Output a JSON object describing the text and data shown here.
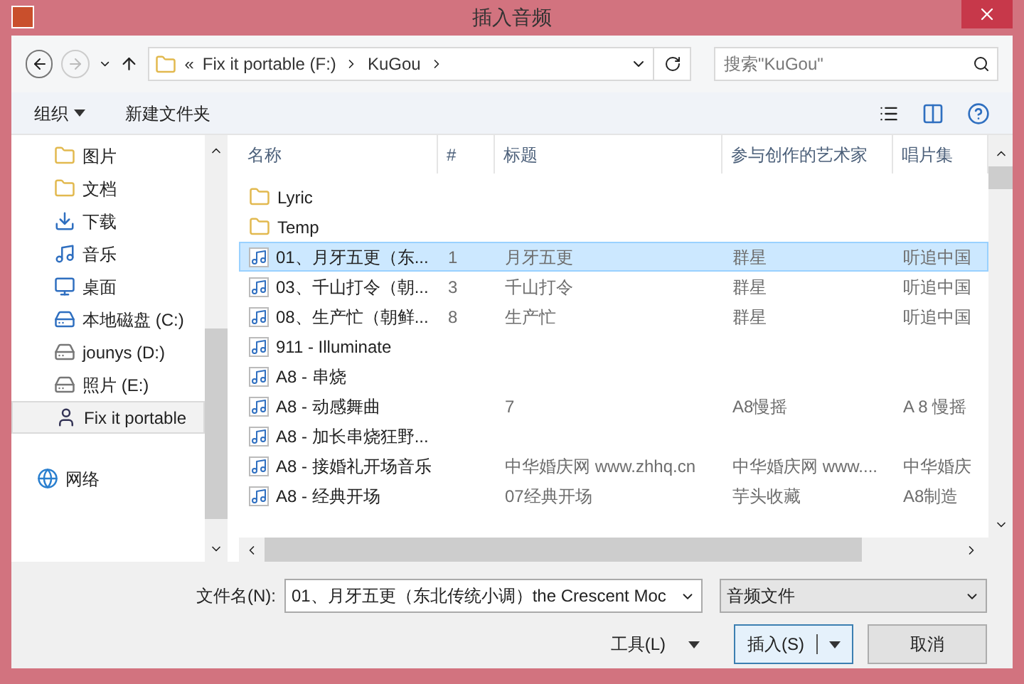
{
  "window": {
    "title": "插入音频"
  },
  "nav": {
    "breadcrumbs": [
      "«",
      "Fix it portable (F:)",
      "KuGou"
    ],
    "search": {
      "placeholder": "搜索\"KuGou\""
    }
  },
  "toolbar": {
    "organize": "组织",
    "new_folder": "新建文件夹"
  },
  "sidebar": {
    "items": [
      {
        "label": "图片",
        "kind": "folder",
        "selected": false
      },
      {
        "label": "文档",
        "kind": "folder",
        "selected": false
      },
      {
        "label": "下载",
        "kind": "download",
        "selected": false
      },
      {
        "label": "音乐",
        "kind": "music",
        "selected": false
      },
      {
        "label": "桌面",
        "kind": "desktop",
        "selected": false
      },
      {
        "label": "本地磁盘 (C:)",
        "kind": "system",
        "selected": false
      },
      {
        "label": "jounys (D:)",
        "kind": "drive",
        "selected": false
      },
      {
        "label": "照片 (E:)",
        "kind": "drive",
        "selected": false
      },
      {
        "label": "Fix it portable",
        "kind": "person",
        "selected": true
      },
      {
        "label": "网络",
        "kind": "network",
        "selected": false
      }
    ]
  },
  "table": {
    "columns": [
      "名称",
      "#",
      "标题",
      "参与创作的艺术家",
      "唱片集"
    ],
    "rows": [
      {
        "kind": "folder",
        "cells": [
          "Lyric",
          "",
          "",
          "",
          ""
        ],
        "selected": false
      },
      {
        "kind": "folder",
        "cells": [
          "Temp",
          "",
          "",
          "",
          ""
        ],
        "selected": false
      },
      {
        "kind": "audio",
        "cells": [
          "01、月牙五更（东...",
          "1",
          "月牙五更",
          "群星",
          "听追中国"
        ],
        "selected": true
      },
      {
        "kind": "audio",
        "cells": [
          "03、千山打令（朝...",
          "3",
          "千山打令",
          "群星",
          "听追中国"
        ],
        "selected": false
      },
      {
        "kind": "audio",
        "cells": [
          "08、生产忙（朝鲜...",
          "8",
          "生产忙",
          "群星",
          "听追中国"
        ],
        "selected": false
      },
      {
        "kind": "audio",
        "cells": [
          "911 - Illuminate",
          "",
          "",
          "",
          ""
        ],
        "selected": false
      },
      {
        "kind": "audio",
        "cells": [
          "A8 - 串烧",
          "",
          "",
          "",
          ""
        ],
        "selected": false
      },
      {
        "kind": "audio",
        "cells": [
          "A8 - 动感舞曲",
          "",
          "7",
          "A8慢摇",
          "A 8 慢摇"
        ],
        "selected": false
      },
      {
        "kind": "audio",
        "cells": [
          "A8 - 加长串烧狂野...",
          "",
          "",
          "",
          ""
        ],
        "selected": false
      },
      {
        "kind": "audio",
        "cells": [
          "A8 - 接婚礼开场音乐",
          "",
          "中华婚庆网 www.zhhq.cn",
          "中华婚庆网 www....",
          "中华婚庆"
        ],
        "selected": false
      },
      {
        "kind": "audio",
        "cells": [
          "A8 - 经典开场",
          "",
          "07经典开场",
          "芋头收藏",
          "A8制造"
        ],
        "selected": false
      }
    ]
  },
  "footer": {
    "filename_label": "文件名(N):",
    "filename": "01、月牙五更（东北传统小调）the Crescent Moc",
    "filetype": "音频文件",
    "tools": "工具(L)",
    "insert": "插入(S)",
    "cancel": "取消"
  }
}
